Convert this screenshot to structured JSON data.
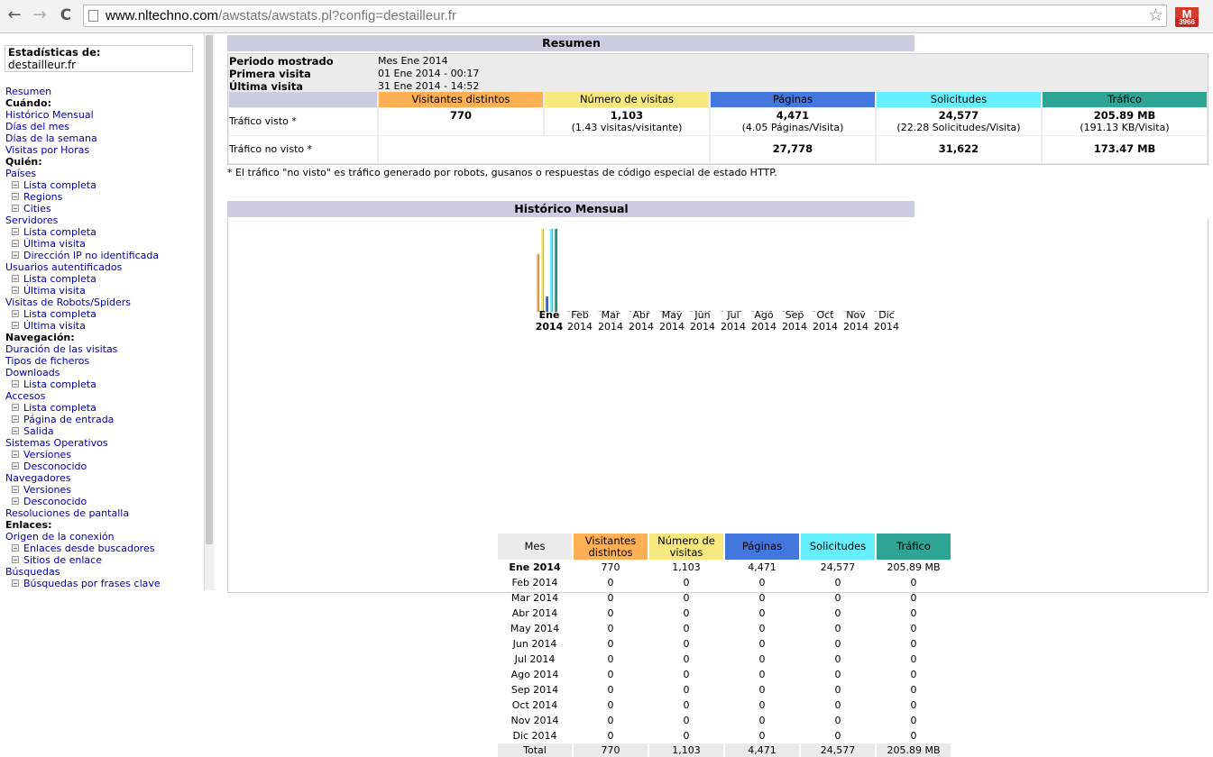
{
  "browser": {
    "url_host": "www.nltechno.com",
    "url_path": "/awstats/awstats.pl?config=destailleur.fr",
    "back_glyph": "←",
    "forward_glyph": "→",
    "reload_glyph": "C",
    "star_glyph": "☆",
    "ext_label": "M",
    "ext_badge": "3966"
  },
  "menu": {
    "title": "Estadísticas de:",
    "site": "destailleur.fr",
    "items": [
      {
        "type": "link",
        "label": "Resumen"
      },
      {
        "type": "head",
        "label": "Cuándo:"
      },
      {
        "type": "link",
        "label": "Histórico Mensual"
      },
      {
        "type": "link",
        "label": "Días del mes"
      },
      {
        "type": "link",
        "label": "Días de la semana"
      },
      {
        "type": "link",
        "label": "Visitas por Horas"
      },
      {
        "type": "head",
        "label": "Quién:"
      },
      {
        "type": "link",
        "label": "Países"
      },
      {
        "type": "sub",
        "label": "Lista completa"
      },
      {
        "type": "sub",
        "label": "Regions"
      },
      {
        "type": "sub",
        "label": "Cities"
      },
      {
        "type": "link",
        "label": "Servidores"
      },
      {
        "type": "sub",
        "label": "Lista completa"
      },
      {
        "type": "sub",
        "label": "Última visita"
      },
      {
        "type": "sub",
        "label": "Dirección IP no identificada"
      },
      {
        "type": "link",
        "label": "Usuarios autentificados"
      },
      {
        "type": "sub",
        "label": "Lista completa"
      },
      {
        "type": "sub",
        "label": "Última visita"
      },
      {
        "type": "link",
        "label": "Visitas de Robots/Spiders"
      },
      {
        "type": "sub",
        "label": "Lista completa"
      },
      {
        "type": "sub",
        "label": "Última visita"
      },
      {
        "type": "head",
        "label": "Navegación:"
      },
      {
        "type": "link",
        "label": "Duración de las visitas"
      },
      {
        "type": "link",
        "label": "Tipos de ficheros"
      },
      {
        "type": "link",
        "label": "Downloads"
      },
      {
        "type": "sub",
        "label": "Lista completa"
      },
      {
        "type": "link",
        "label": "Accesos"
      },
      {
        "type": "sub",
        "label": "Lista completa"
      },
      {
        "type": "sub",
        "label": "Página de entrada"
      },
      {
        "type": "sub",
        "label": "Salida"
      },
      {
        "type": "link",
        "label": "Sistemas Operativos"
      },
      {
        "type": "sub",
        "label": "Versiones"
      },
      {
        "type": "sub",
        "label": "Desconocido"
      },
      {
        "type": "link",
        "label": "Navegadores"
      },
      {
        "type": "sub",
        "label": "Versiones"
      },
      {
        "type": "sub",
        "label": "Desconocido"
      },
      {
        "type": "link",
        "label": "Resoluciones de pantalla"
      },
      {
        "type": "head",
        "label": "Enlaces:"
      },
      {
        "type": "link",
        "label": "Origen de la conexión"
      },
      {
        "type": "sub",
        "label": "Enlaces desde buscadores"
      },
      {
        "type": "sub",
        "label": "Sitios de enlace"
      },
      {
        "type": "link",
        "label": "Búsquedas"
      },
      {
        "type": "sub",
        "label": "Búsquedas por frases clave"
      }
    ]
  },
  "summary": {
    "title": "Resumen",
    "period_label": "Periodo mostrado",
    "period_value": "Mes Ene 2014",
    "first_label": "Primera visita",
    "first_value": "01 Ene 2014 - 00:17",
    "last_label": "Última visita",
    "last_value": "31 Ene 2014 - 14:52",
    "headers": [
      "Visitantes distintos",
      "Número de visitas",
      "Páginas",
      "Solicitudes",
      "Tráfico"
    ],
    "viewed_label": "Tráfico visto *",
    "viewed": [
      {
        "main": "770",
        "sub": ""
      },
      {
        "main": "1,103",
        "sub": "(1.43 visitas/visitante)"
      },
      {
        "main": "4,471",
        "sub": "(4.05 Páginas/Visita)"
      },
      {
        "main": "24,577",
        "sub": "(22.28 Solicitudes/Visita)"
      },
      {
        "main": "205.89 MB",
        "sub": "(191.13 KB/Visita)"
      }
    ],
    "notviewed_label": "Tráfico no visto *",
    "notviewed": [
      "27,778",
      "31,622",
      "173.47 MB"
    ],
    "note": "* El tráfico \"no visto\" es tráfico generado por robots, gusanos o respuestas de código especial de estado HTTP."
  },
  "colors": {
    "visitors": "#ffb055",
    "visits": "#f8e880",
    "pages": "#4477dd",
    "hits": "#66f0ff",
    "bandwidth": "#2ea495",
    "title_bg": "#cccce0",
    "link": "#0000aa"
  },
  "history": {
    "title": "Histórico Mensual",
    "months": [
      {
        "m": "Ene",
        "y": "2014"
      },
      {
        "m": "Feb",
        "y": "2014"
      },
      {
        "m": "Mar",
        "y": "2014"
      },
      {
        "m": "Abr",
        "y": "2014"
      },
      {
        "m": "May",
        "y": "2014"
      },
      {
        "m": "Jun",
        "y": "2014"
      },
      {
        "m": "Jul",
        "y": "2014"
      },
      {
        "m": "Ago",
        "y": "2014"
      },
      {
        "m": "Sep",
        "y": "2014"
      },
      {
        "m": "Oct",
        "y": "2014"
      },
      {
        "m": "Nov",
        "y": "2014"
      },
      {
        "m": "Dic",
        "y": "2014"
      }
    ],
    "table_headers": [
      "Mes",
      "Visitantes distintos",
      "Número de visitas",
      "Páginas",
      "Solicitudes",
      "Tráfico"
    ],
    "rows": [
      [
        "Ene 2014",
        "770",
        "1,103",
        "4,471",
        "24,577",
        "205.89 MB"
      ],
      [
        "Feb 2014",
        "0",
        "0",
        "0",
        "0",
        "0"
      ],
      [
        "Mar 2014",
        "0",
        "0",
        "0",
        "0",
        "0"
      ],
      [
        "Abr 2014",
        "0",
        "0",
        "0",
        "0",
        "0"
      ],
      [
        "May 2014",
        "0",
        "0",
        "0",
        "0",
        "0"
      ],
      [
        "Jun 2014",
        "0",
        "0",
        "0",
        "0",
        "0"
      ],
      [
        "Jul 2014",
        "0",
        "0",
        "0",
        "0",
        "0"
      ],
      [
        "Ago 2014",
        "0",
        "0",
        "0",
        "0",
        "0"
      ],
      [
        "Sep 2014",
        "0",
        "0",
        "0",
        "0",
        "0"
      ],
      [
        "Oct 2014",
        "0",
        "0",
        "0",
        "0",
        "0"
      ],
      [
        "Nov 2014",
        "0",
        "0",
        "0",
        "0",
        "0"
      ],
      [
        "Dic 2014",
        "0",
        "0",
        "0",
        "0",
        "0"
      ]
    ],
    "total": [
      "Total",
      "770",
      "1,103",
      "4,471",
      "24,577",
      "205.89 MB"
    ]
  },
  "chart_data": {
    "type": "bar",
    "categories": [
      "Ene 2014",
      "Feb 2014",
      "Mar 2014",
      "Abr 2014",
      "May 2014",
      "Jun 2014",
      "Jul 2014",
      "Ago 2014",
      "Sep 2014",
      "Oct 2014",
      "Nov 2014",
      "Dic 2014"
    ],
    "series": [
      {
        "name": "Visitantes distintos",
        "values": [
          770,
          0,
          0,
          0,
          0,
          0,
          0,
          0,
          0,
          0,
          0,
          0
        ]
      },
      {
        "name": "Número de visitas",
        "values": [
          1103,
          0,
          0,
          0,
          0,
          0,
          0,
          0,
          0,
          0,
          0,
          0
        ]
      },
      {
        "name": "Páginas",
        "values": [
          4471,
          0,
          0,
          0,
          0,
          0,
          0,
          0,
          0,
          0,
          0,
          0
        ]
      },
      {
        "name": "Solicitudes",
        "values": [
          24577,
          0,
          0,
          0,
          0,
          0,
          0,
          0,
          0,
          0,
          0,
          0
        ]
      },
      {
        "name": "Tráfico",
        "values": [
          205.89,
          0,
          0,
          0,
          0,
          0,
          0,
          0,
          0,
          0,
          0,
          0
        ]
      }
    ]
  }
}
